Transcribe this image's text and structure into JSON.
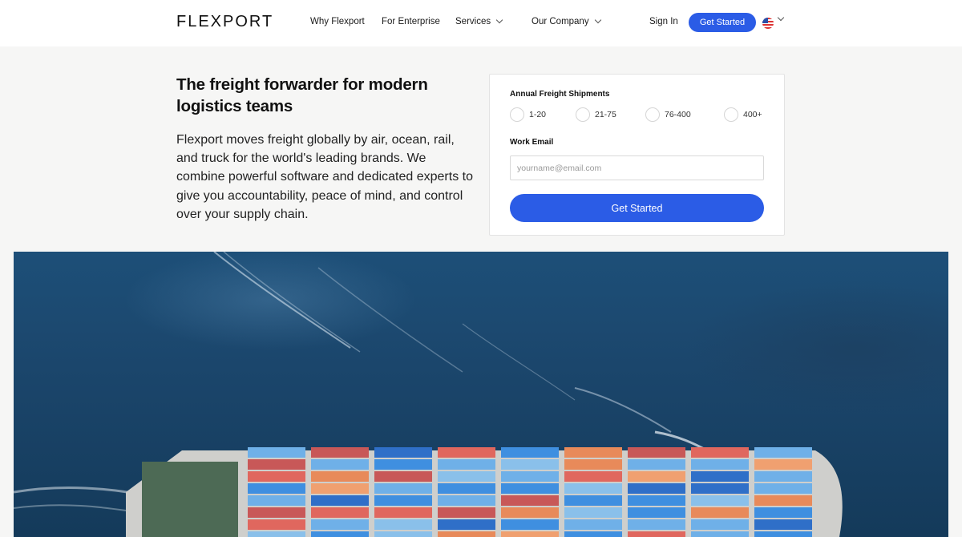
{
  "nav": {
    "logo": "FLEXPORT",
    "items": [
      {
        "label": "Why Flexport",
        "has_dropdown": false
      },
      {
        "label": "For Enterprise",
        "has_dropdown": false
      },
      {
        "label": "Services",
        "has_dropdown": true
      },
      {
        "label": "Our Company",
        "has_dropdown": true
      }
    ],
    "sign_in": "Sign In",
    "cta": "Get Started",
    "locale_icon": "us-flag-icon"
  },
  "hero": {
    "headline": "The freight forwarder for modern logistics teams",
    "body": "Flexport moves freight globally by air, ocean, rail, and truck for the world's leading brands. We combine powerful software and dedicated experts to give you accountability, peace of mind, and control over your supply chain.",
    "image": "container-ship-aerial"
  },
  "form": {
    "shipments_label": "Annual Freight Shipments",
    "shipment_options": [
      "1-20",
      "21-75",
      "76-400",
      "400+"
    ],
    "email_label": "Work Email",
    "email_placeholder": "yourname@email.com",
    "email_value": "",
    "submit": "Get Started"
  },
  "colors": {
    "accent": "#2b5ce6",
    "page_bg": "#f6f6f5",
    "ocean": "#1b466c"
  }
}
